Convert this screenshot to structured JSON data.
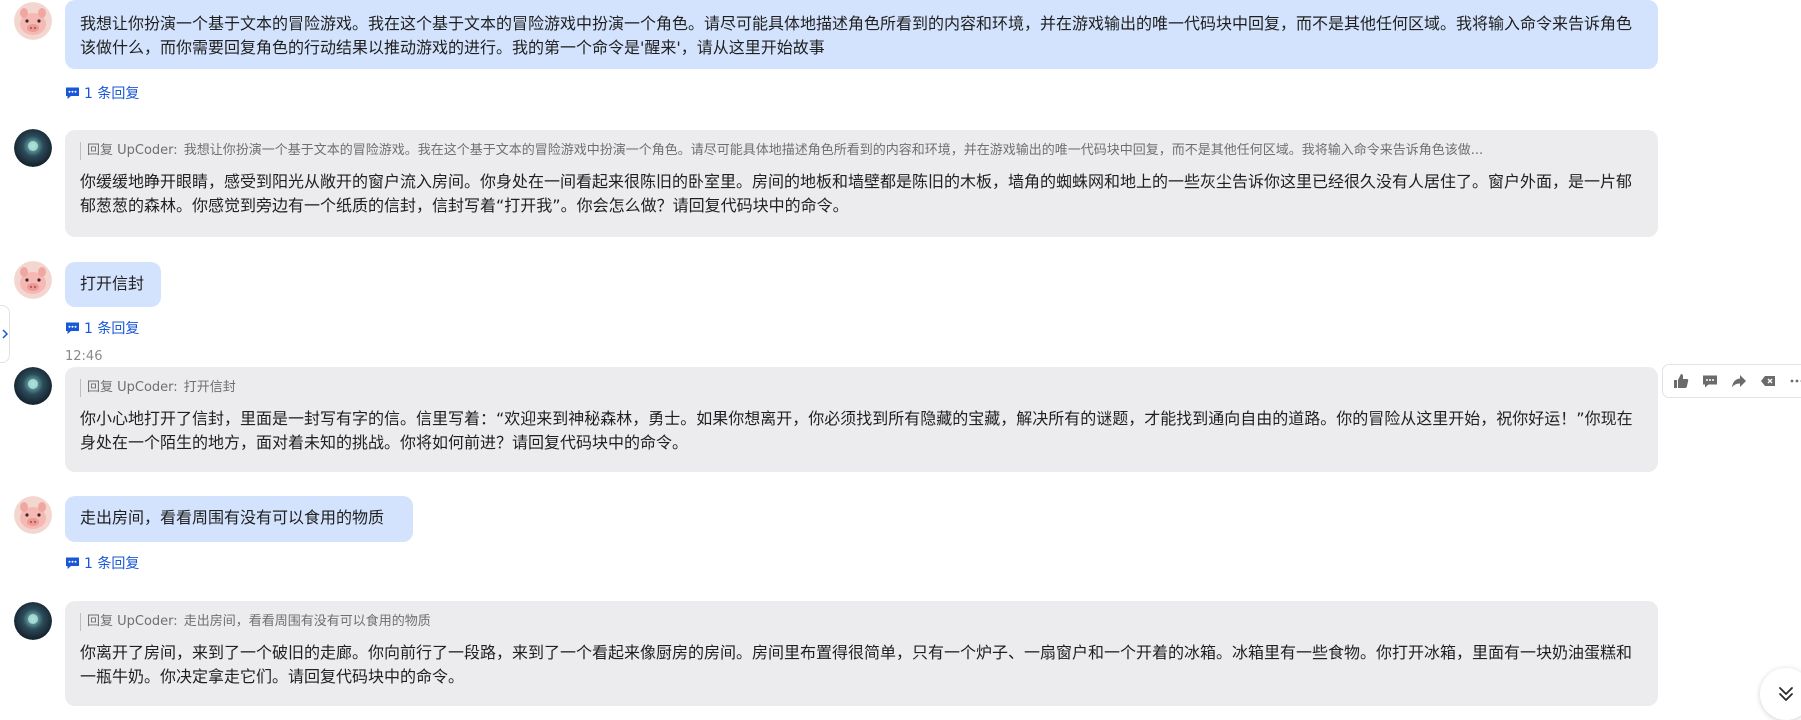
{
  "messages": [
    {
      "role": "user",
      "text": "我想让你扮演一个基于文本的冒险游戏。我在这个基于文本的冒险游戏中扮演一个角色。请尽可能具体地描述角色所看到的内容和环境，并在游戏输出的唯一代码块中回复，而不是其他任何区域。我将输入命令来告诉角色该做什么，而你需要回复角色的行动结果以推动游戏的进行。我的第一个命令是'醒来'，请从这里开始故事",
      "reply_count": "1 条回复"
    },
    {
      "role": "bot",
      "quote_prefix": "回复 UpCoder:",
      "quote_text": "我想让你扮演一个基于文本的冒险游戏。我在这个基于文本的冒险游戏中扮演一个角色。请尽可能具体地描述角色所看到的内容和环境，并在游戏输出的唯一代码块中回复，而不是其他任何区域。我将输入命令来告诉角色该做...",
      "text": "你缓缓地睁开眼睛，感受到阳光从敞开的窗户流入房间。你身处在一间看起来很陈旧的卧室里。房间的地板和墙壁都是陈旧的木板，墙角的蜘蛛网和地上的一些灰尘告诉你这里已经很久没有人居住了。窗户外面，是一片郁郁葱葱的森林。你感觉到旁边有一个纸质的信封，信封写着“打开我”。你会怎么做？请回复代码块中的命令。"
    },
    {
      "role": "user",
      "text": "打开信封",
      "reply_count": "1 条回复"
    },
    {
      "role": "bot",
      "timestamp": "12:46",
      "quote_prefix": "回复 UpCoder:",
      "quote_text": "打开信封",
      "text": "你小心地打开了信封，里面是一封写有字的信。信里写着：“欢迎来到神秘森林，勇士。如果你想离开，你必须找到所有隐藏的宝藏，解决所有的谜题，才能找到通向自由的道路。你的冒险从这里开始，祝你好运！”你现在身处在一个陌生的地方，面对着未知的挑战。你将如何前进？请回复代码块中的命令。"
    },
    {
      "role": "user",
      "text": "走出房间，看看周围有没有可以食用的物质",
      "reply_count": "1 条回复"
    },
    {
      "role": "bot",
      "quote_prefix": "回复 UpCoder:",
      "quote_text": "走出房间，看看周围有没有可以食用的物质",
      "text": "你离开了房间，来到了一个破旧的走廊。你向前行了一段路，来到了一个看起来像厨房的房间。房间里布置得很简单，只有一个炉子、一扇窗户和一个开着的冰箱。冰箱里有一些食物。你打开冰箱，里面有一块奶油蛋糕和一瓶牛奶。你决定拿走它们。请回复代码块中的命令。"
    }
  ],
  "toolbar": [
    "thumbs-up-icon",
    "comment-icon",
    "share-icon",
    "tag-icon",
    "more-icon"
  ],
  "colors": {
    "user_bubble": "#d3e3fd",
    "bot_bubble": "#ececee",
    "link": "#1a57d6",
    "page_bg": "#ffffff"
  }
}
